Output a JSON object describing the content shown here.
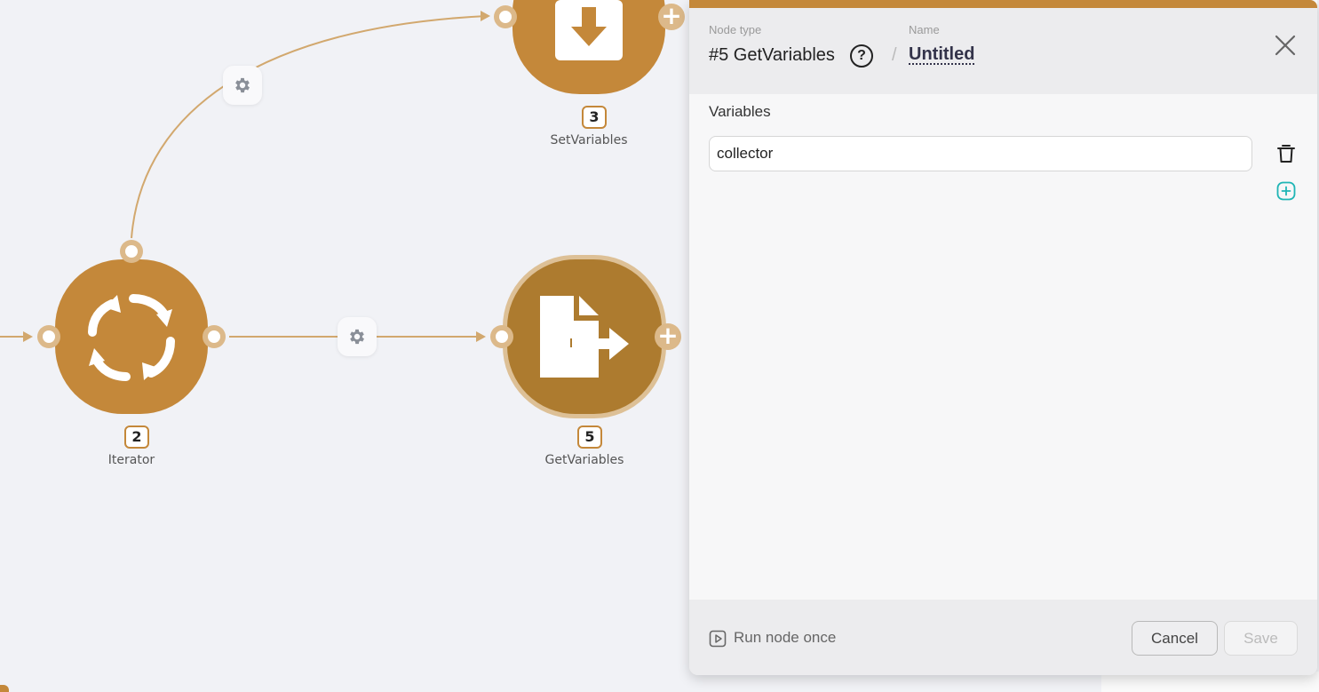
{
  "nodes": [
    {
      "id": "node-2",
      "badge": "2",
      "label": "Iterator",
      "icon": "refresh-icon"
    },
    {
      "id": "node-3",
      "badge": "3",
      "label": "SetVariables",
      "icon": "download-icon"
    },
    {
      "id": "node-5",
      "badge": "5",
      "label": "GetVariables",
      "icon": "file-export-icon"
    }
  ],
  "panel": {
    "node_type_label": "Node type",
    "node_type_value": "#5 GetVariables",
    "help_glyph": "?",
    "separator": "/",
    "name_label": "Name",
    "name_value": "Untitled",
    "variables_label": "Variables",
    "variables": [
      "collector"
    ],
    "run_once_label": "Run node once",
    "cancel_label": "Cancel",
    "save_label": "Save"
  },
  "colors": {
    "node": "#c4883a",
    "node_selected": "#ad7b2f",
    "edge": "#d2a86e",
    "accent_add": "#1fb5b5"
  }
}
